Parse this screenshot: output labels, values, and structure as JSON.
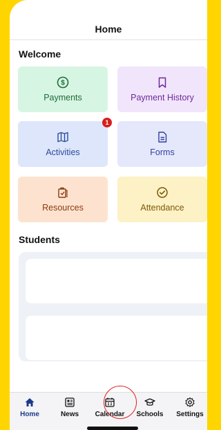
{
  "header": {
    "title": "Home"
  },
  "welcome": {
    "title": "Welcome"
  },
  "tiles": [
    {
      "label": "Payments",
      "icon": "dollar-circle-icon",
      "bg": "#d7f5e3",
      "fg": "#1e6b3a"
    },
    {
      "label": "Payment History",
      "icon": "bookmark-icon",
      "bg": "#f1e5fb",
      "fg": "#6e2a9c"
    },
    {
      "label": "Activities",
      "icon": "map-icon",
      "bg": "#dde6fb",
      "fg": "#2b4a9e",
      "badge": "1"
    },
    {
      "label": "Forms",
      "icon": "document-icon",
      "bg": "#e5e8fb",
      "fg": "#2f3f9e"
    },
    {
      "label": "Resources",
      "icon": "clipboard-icon",
      "bg": "#fde3cf",
      "fg": "#8a3a10"
    },
    {
      "label": "Attendance",
      "icon": "check-circle-icon",
      "bg": "#fdf1c6",
      "fg": "#7a5a06"
    }
  ],
  "students": {
    "title": "Students"
  },
  "tabbar": {
    "items": [
      {
        "label": "Home",
        "icon": "home-icon",
        "active": true
      },
      {
        "label": "News",
        "icon": "newspaper-icon"
      },
      {
        "label": "Calendar",
        "icon": "calendar-icon"
      },
      {
        "label": "Schools",
        "icon": "graduation-cap-icon"
      },
      {
        "label": "Settings",
        "icon": "gear-icon"
      }
    ]
  },
  "colors": {
    "accent": "#FFD500",
    "active_tab": "#1d3a8a",
    "highlight": "#e02020"
  }
}
